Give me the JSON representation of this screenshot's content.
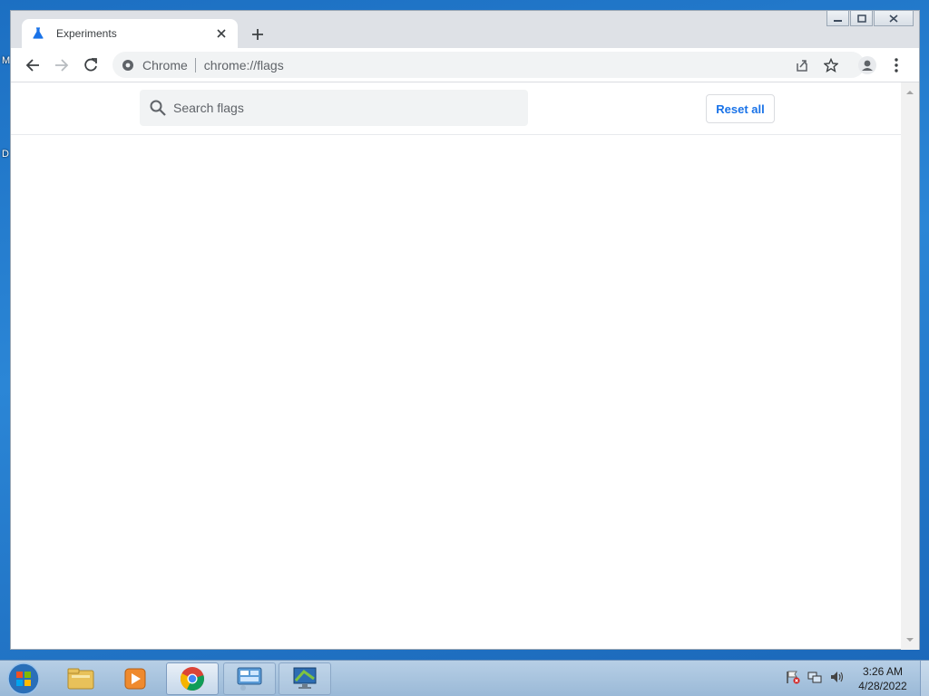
{
  "desktop": {
    "label_m": "M",
    "label_d": "D"
  },
  "window": {
    "tab": {
      "title": "Experiments",
      "favicon": "flask-icon"
    },
    "caption": {
      "minimize": "minimize-icon",
      "restore": "restore-icon",
      "close": "close-icon"
    }
  },
  "toolbar": {
    "omnibox": {
      "origin": "Chrome",
      "url": "chrome://flags"
    }
  },
  "flags": {
    "search_placeholder": "Search flags",
    "reset_label": "Reset all"
  },
  "taskbar": {
    "items": [
      "start-orb-icon",
      "file-explorer-icon",
      "media-player-icon",
      "chrome-icon",
      "control-panel-icon",
      "remote-desktop-icon"
    ],
    "active_item": "chrome-icon",
    "clock_time": "3:26 AM",
    "clock_date": "4/28/2022"
  },
  "colors": {
    "accent": "#1a73e8",
    "tab_bar": "#dee1e6",
    "omnibox_bg": "#f1f3f4",
    "taskbar": "#a9c4df"
  }
}
